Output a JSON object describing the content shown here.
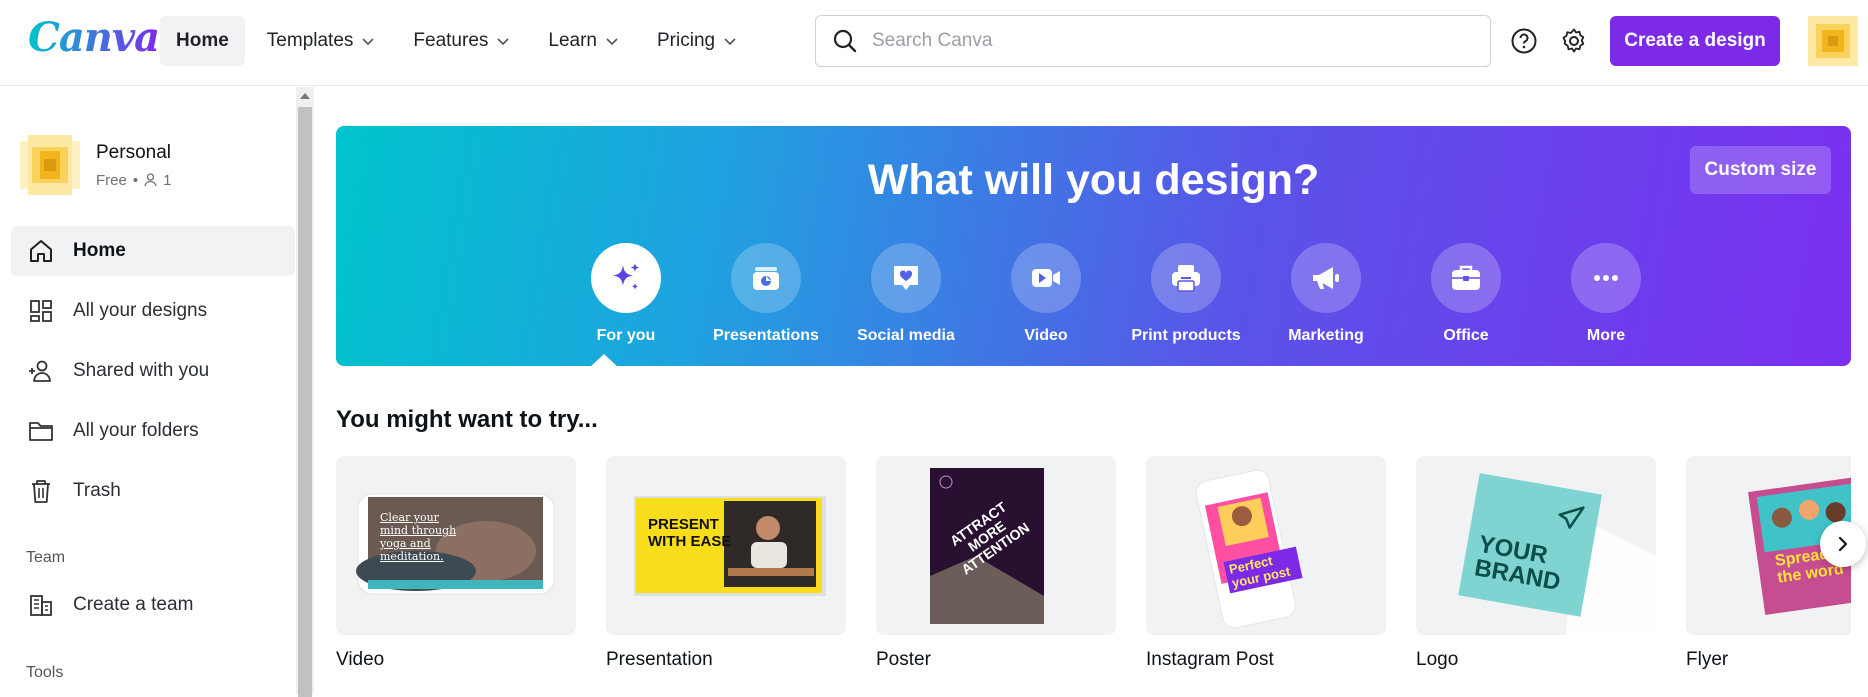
{
  "brand": {
    "logo_text": "Canva",
    "accent": "#7d2ae8",
    "teal": "#00c4cc"
  },
  "nav": [
    {
      "label": "Home",
      "active": true,
      "dropdown": false
    },
    {
      "label": "Templates",
      "dropdown": true
    },
    {
      "label": "Features",
      "dropdown": true
    },
    {
      "label": "Learn",
      "dropdown": true
    },
    {
      "label": "Pricing",
      "dropdown": true
    }
  ],
  "search": {
    "placeholder": "Search Canva",
    "value": ""
  },
  "header": {
    "help_icon": "help-circle-icon",
    "settings_icon": "gear-icon",
    "create_label": "Create a design"
  },
  "account": {
    "name": "Personal",
    "plan": "Free",
    "members": "1"
  },
  "sidebar": {
    "items": [
      {
        "label": "Home",
        "icon": "home-icon",
        "active": true
      },
      {
        "label": "All your designs",
        "icon": "grid-icon"
      },
      {
        "label": "Shared with you",
        "icon": "people-icon"
      },
      {
        "label": "All your folders",
        "icon": "folder-icon"
      },
      {
        "label": "Trash",
        "icon": "trash-icon"
      }
    ],
    "team_heading": "Team",
    "team_item": {
      "label": "Create a team",
      "icon": "building-icon"
    },
    "tools_heading": "Tools"
  },
  "hero": {
    "title": "What will you design?",
    "custom_size_label": "Custom size",
    "categories": [
      {
        "label": "For you",
        "icon": "sparkle-icon",
        "active": true
      },
      {
        "label": "Presentations",
        "icon": "presentation-icon"
      },
      {
        "label": "Social media",
        "icon": "heart-chat-icon"
      },
      {
        "label": "Video",
        "icon": "video-camera-icon"
      },
      {
        "label": "Print products",
        "icon": "printer-icon"
      },
      {
        "label": "Marketing",
        "icon": "megaphone-icon"
      },
      {
        "label": "Office",
        "icon": "briefcase-icon"
      },
      {
        "label": "More",
        "icon": "more-dots-icon"
      }
    ]
  },
  "suggestions": {
    "title": "You might want to try...",
    "cards": [
      {
        "label": "Video",
        "thumb_text": "Clear your mind through yoga and meditation."
      },
      {
        "label": "Presentation",
        "thumb_text": "PRESENT WITH EASE"
      },
      {
        "label": "Poster",
        "thumb_text": "ATTRACT MORE ATTENTION"
      },
      {
        "label": "Instagram Post",
        "thumb_text": "Perfect your post"
      },
      {
        "label": "Logo",
        "thumb_text": "YOUR BRAND"
      },
      {
        "label": "Flyer",
        "thumb_text": "Spread the word"
      }
    ]
  }
}
